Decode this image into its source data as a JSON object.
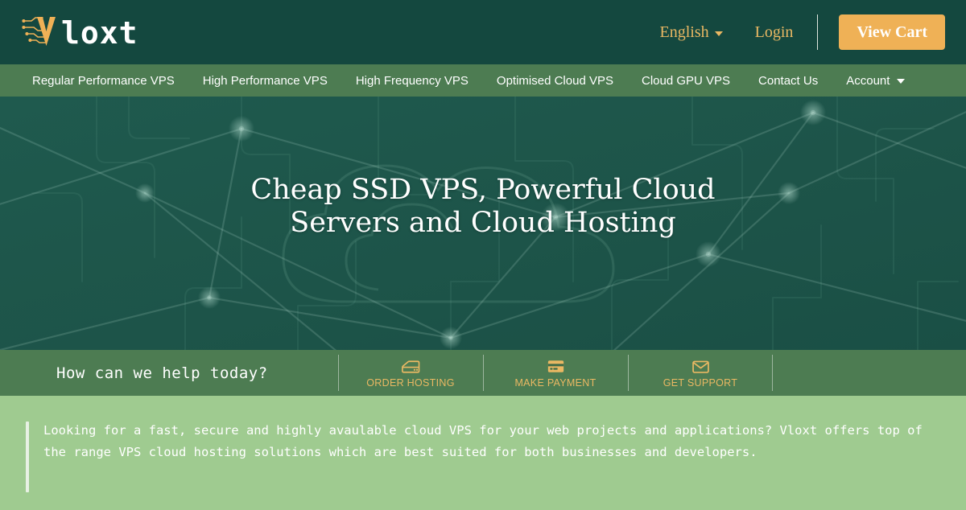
{
  "brand": {
    "logo_icon": "circuit-v-logo-icon",
    "name": "loxt",
    "full_name": "Vloxt"
  },
  "topbar": {
    "language_label": "English",
    "language_caret_icon": "chevron-down-icon",
    "login_label": "Login",
    "cart_label": "View Cart",
    "accent_color": "#efb156",
    "background_color": "#14483f"
  },
  "nav": {
    "items": [
      {
        "label": "Regular Performance VPS"
      },
      {
        "label": "High Performance VPS"
      },
      {
        "label": "High Frequency VPS"
      },
      {
        "label": "Optimised Cloud VPS"
      },
      {
        "label": "Cloud GPU VPS"
      },
      {
        "label": "Contact Us"
      }
    ],
    "account_label": "Account",
    "account_caret_icon": "chevron-down-icon",
    "background_color": "#4d7c52"
  },
  "hero": {
    "title_line1": "Cheap SSD VPS, Powerful Cloud",
    "title_line2": "Servers and Cloud Hosting",
    "background_color": "#1d5449"
  },
  "helpbar": {
    "question": "How can we help today?",
    "actions": [
      {
        "label": "ORDER HOSTING",
        "icon": "server-icon"
      },
      {
        "label": "MAKE PAYMENT",
        "icon": "credit-card-icon"
      },
      {
        "label": "GET SUPPORT",
        "icon": "envelope-icon"
      }
    ],
    "label_color": "#eab863",
    "background_color": "#4d7c52"
  },
  "content": {
    "intro_paragraph": "Looking for a fast, secure and highly avaulable cloud VPS for your web projects and applications? Vloxt offers top of the range VPS cloud hosting solutions which are best suited for both businesses and developers.",
    "background_color": "#9fcb90"
  }
}
